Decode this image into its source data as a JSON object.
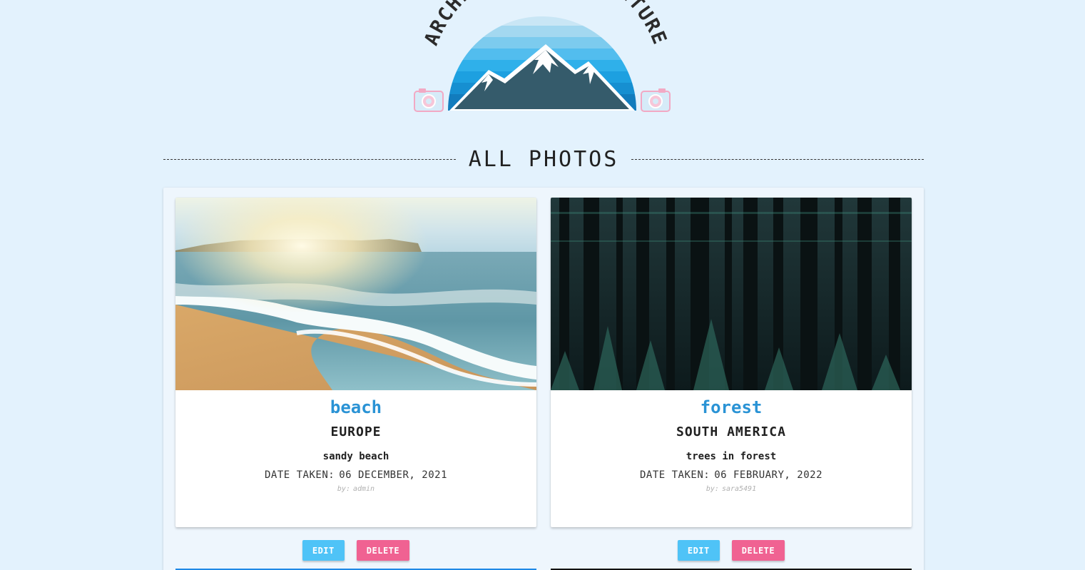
{
  "logo": {
    "arc_text": "ARCHIVE YOUR ADVENTURE"
  },
  "section": {
    "title": "ALL PHOTOS"
  },
  "photos": [
    {
      "title": "beach",
      "location": "EUROPE",
      "description": "sandy beach",
      "date_label": "DATE TAKEN:",
      "date": "06 DECEMBER, 2021",
      "by_label": "by:",
      "author": "admin",
      "image_icon": "beach-photo",
      "edit_label": "EDIT",
      "delete_label": "DELETE"
    },
    {
      "title": "forest",
      "location": "SOUTH AMERICA",
      "description": "trees in forest",
      "date_label": "DATE TAKEN:",
      "date": "06 FEBRUARY, 2022",
      "by_label": "by:",
      "author": "sara5491",
      "image_icon": "forest-photo",
      "edit_label": "EDIT",
      "delete_label": "DELETE"
    }
  ],
  "colors": {
    "page_bg": "#e3f2fd",
    "title_blue": "#2a93d5",
    "edit_button": "#4fc3f7",
    "delete_button": "#f06292"
  }
}
